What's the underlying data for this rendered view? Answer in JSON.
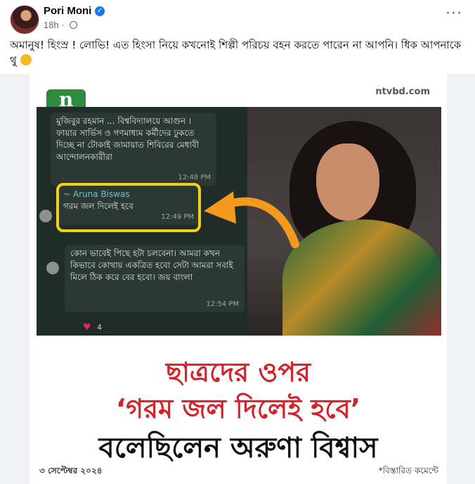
{
  "post": {
    "author": "Pori Moni",
    "time": "18h",
    "caption": "অমানুষ!  হিংস্র ! লোভি! এত হিংসা নিয়ে কখনোই শিল্পী পরিচয় বহন করতে পারেন না আপনি। ধিক আপনাকে থু"
  },
  "poster": {
    "logo_main": "n",
    "logo_sub": "online",
    "site": "ntvbd.com",
    "chat": {
      "msg1": "মুজিবুর রহমান ... বিশ্ববিদ্যালয়ে আগুন ।ফায়ার সার্ভিস ও গণমাধ্যম কর্মীদের ঢুকতে দিচ্ছে না টোকাই জামায়াত শিবিরের মেধাবী আন্দোলনকারীরা",
      "msg1_time": "12:48 PM",
      "sender": "~ Aruna Biswas",
      "msg2": "গরম জল দিলেই হবে",
      "msg2_time": "12:49 PM",
      "msg3": "কোন ভাবেই পিছে হটা চলবেনা। আমরা কখন কিভাবে কোথায় একত্রিত হবো সেটা আমরা সবাই মিলে ঠিক করে বের হবো। জয় বাংলা",
      "msg3_time": "12:54 PM",
      "reaction_count": "4"
    },
    "headline_1": "ছাত্রদের ওপর",
    "headline_2": "‘গরম জল দিলেই হবে’",
    "headline_3": "বলেছিলেন অরুণা বিশ্বাস",
    "date": "৩ সেপ্টেম্বর ২০২৪",
    "note": "*বিস্তারিত কমেন্টে"
  }
}
